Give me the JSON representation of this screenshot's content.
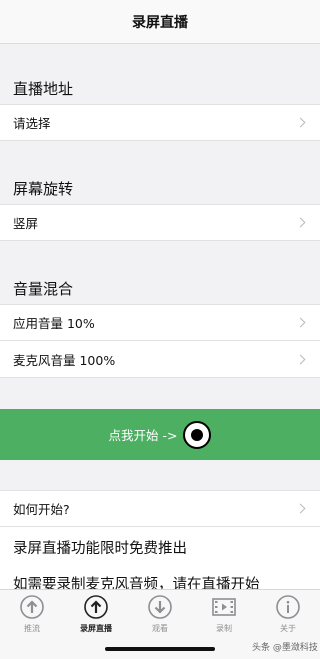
{
  "nav": {
    "title": "录屏直播"
  },
  "sections": {
    "address": {
      "header": "直播地址",
      "row_label": "请选择"
    },
    "rotation": {
      "header": "屏幕旋转",
      "row_label": "竖屏"
    },
    "audio": {
      "header": "音量混合",
      "app_volume": "应用音量 10%",
      "mic_volume": "麦克风音量 100%"
    }
  },
  "start_button": {
    "label": "点我开始 ->"
  },
  "help_row": {
    "label": "如何开始?"
  },
  "info": {
    "title": "录屏直播功能限时免费推出",
    "body": "如需要录制麦克风音频，请在直播开始"
  },
  "tabbar": {
    "items": [
      {
        "label": "推流",
        "icon": "upload-circle-icon",
        "active": false
      },
      {
        "label": "录屏直播",
        "icon": "upload-circle-icon",
        "active": true
      },
      {
        "label": "观看",
        "icon": "download-circle-icon",
        "active": false
      },
      {
        "label": "录制",
        "icon": "film-icon",
        "active": false
      },
      {
        "label": "关于",
        "icon": "info-circle-icon",
        "active": false
      }
    ]
  },
  "watermark": "头条 @墨潋科技",
  "colors": {
    "accent_green": "#4caf62",
    "background": "#f2f2f4"
  }
}
